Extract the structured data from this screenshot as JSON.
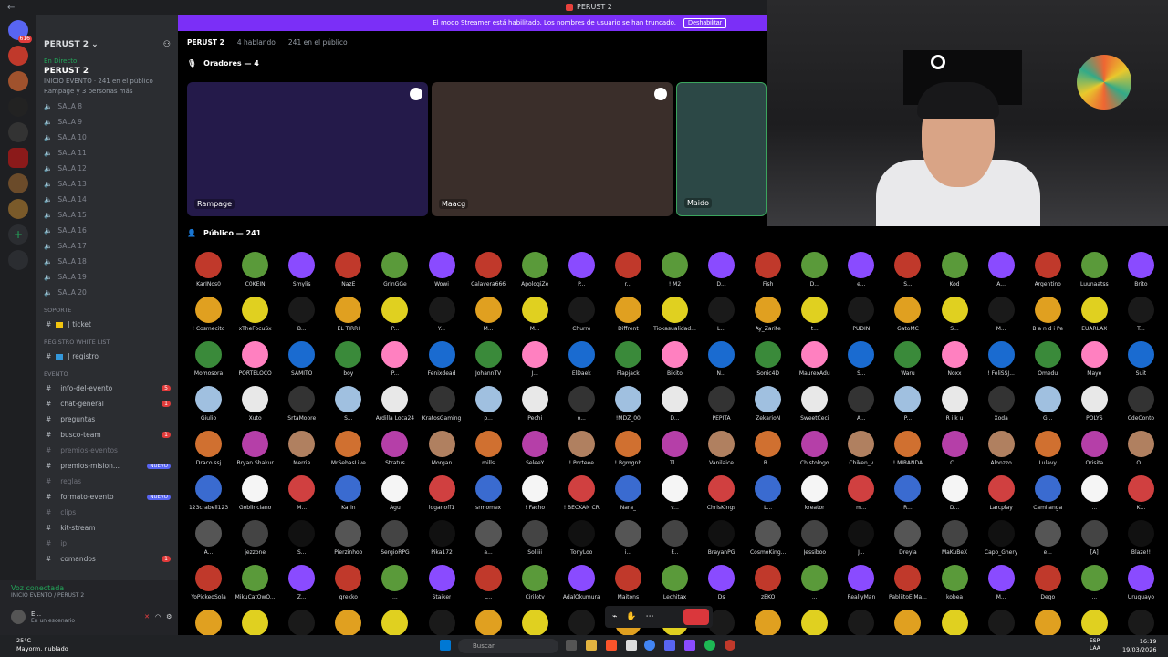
{
  "window": {
    "title": "PERUST 2"
  },
  "banner": {
    "text": "El modo Streamer está habilitado. Los nombres de usuario se han truncado.",
    "button": "Deshabilitar"
  },
  "server": {
    "name": "PERUST 2 ⌄",
    "live_label": "En Directo",
    "live_title": "PERUST 2",
    "live_sub1": "INICIO EVENTO · 241 en el público",
    "live_sub2": "Rampage y 3 personas más"
  },
  "voice_channels": [
    "SALA 8",
    "SALA 9",
    "SALA 10",
    "SALA 11",
    "SALA 12",
    "SALA 13",
    "SALA 14",
    "SALA 15",
    "SALA 16",
    "SALA 17",
    "SALA 18",
    "SALA 19",
    "SALA 20"
  ],
  "categories": {
    "soporte": "SOPORTE",
    "registro": "REGISTRO WHITE LIST",
    "evento": "EVENTO"
  },
  "text_channels": {
    "ticket": "| ticket",
    "registro": "| registro",
    "evento": [
      {
        "name": "| info-del-evento",
        "badge": "5"
      },
      {
        "name": "| chat-general",
        "badge": "1"
      },
      {
        "name": "| preguntas",
        "badge": ""
      },
      {
        "name": "| busco-team",
        "badge": "1"
      },
      {
        "name": "| premios-eventos",
        "badge": "",
        "dim": true
      },
      {
        "name": "| premios-mision...",
        "badge": "NUEVO"
      },
      {
        "name": "| reglas",
        "badge": "",
        "dim": true
      },
      {
        "name": "| formato-evento",
        "badge": "NUEVO"
      },
      {
        "name": "| clips",
        "badge": "",
        "dim": true
      },
      {
        "name": "| kit-stream",
        "badge": ""
      },
      {
        "name": "| ip",
        "badge": "",
        "dim": true
      },
      {
        "name": "| comandos",
        "badge": "1"
      }
    ]
  },
  "voice_status": {
    "title": "Voz conectada",
    "sub": "INICIO EVENTO / PERUST 2",
    "user": "E...",
    "user_sub": "En un escenario"
  },
  "stage": {
    "title": "PERUST 2",
    "speaking": "4 hablando",
    "audience": "241 en el público",
    "speakers_label": "Oradores — 4",
    "audience_label": "Público — 241"
  },
  "speakers": [
    {
      "name": "Rampage",
      "color": "#241a4a"
    },
    {
      "name": "Maacg",
      "color": "#3a2e2a"
    },
    {
      "name": "Maido",
      "color": "#2c4846"
    }
  ],
  "audience_names": [
    "KarIÑos0",
    "C0KEIN",
    "Smylis",
    "NazE",
    "GrinGGe",
    "Wowi",
    "Calavera666",
    "ApologiZe",
    "P...",
    "r...",
    "! M2",
    "D...",
    "Fish",
    "D...",
    "e...",
    "S...",
    "Kod",
    "A...",
    "Argentino",
    "Luunaatss",
    "Brito",
    "! Cosmecito",
    "xTheFocuSx",
    "B...",
    "EL TIRRI",
    "P...",
    "Y...",
    "M...",
    "M...",
    "Churro",
    "Diffrent",
    "Tiokasualidad...",
    "L...",
    "Ay_Zarite",
    "t...",
    "PUDIN",
    "GatoMC",
    "S...",
    "M...",
    "B a n d i Pe",
    "EUARLAX",
    "T...",
    "Momosora",
    "PORTELOCO",
    "SAMITO",
    "boy",
    "P...",
    "Fenixdead",
    "JohannTV",
    "J...",
    "ElDaek",
    "Flapjack",
    "Bikito",
    "N...",
    "Sonic4D",
    "MaurexAdu",
    "S...",
    "Waru",
    "Noxx",
    "! FeliSSJ...",
    "Omedu",
    "Maye",
    "Suit",
    "Giulio",
    "Xuto",
    "SrtaMoore",
    "S...",
    "Ardilla Loca24",
    "KratosGaming",
    "p...",
    "Pechi",
    "o...",
    "!MDZ_00",
    "D...",
    "PEPITA",
    "ZekarioN",
    "SweetCeci",
    "A...",
    "P...",
    "R i k u",
    "Xoda",
    "G...",
    "POLYS",
    "CdeConto",
    "Draco ssj",
    "Bryan Shakur",
    "Merrie",
    "MrSebasLive",
    "Stratus",
    "Morgan",
    "mills",
    "SeleeY",
    "! Porteee",
    "! Bgmgnh",
    "Tl...",
    "Vanilaice",
    "R...",
    "Chistologo",
    "Chiken_v",
    "! MIRANDA",
    "C...",
    "Alonzzo",
    "Lulavy",
    "Orisita",
    "O...",
    "123crabell123",
    "Goblinciano",
    "M...",
    "Karin",
    "Agu",
    "loganoff1",
    "srmomex",
    "! Facho",
    "! BECKAN CR",
    "Nara_",
    "v...",
    "ChrisKings",
    "L...",
    "kreator",
    "m...",
    "R...",
    "D...",
    "Larcplay",
    "Camilanga",
    "...",
    "K...",
    "A...",
    "jezzone",
    "S...",
    "Pierzinhoo",
    "SergioRPG",
    "Pika172",
    "a...",
    "Soliiii",
    "TonyLoo",
    "i...",
    "F...",
    "BrayanPG",
    "CosmoKing...",
    "Jessiboo",
    "J...",
    "Dreyla",
    "MaKuBeX",
    "Capo_Ghery",
    "e...",
    "[A]",
    "Blaze!!",
    "YoPickeoSola",
    "MikuCatOwO...",
    "Z...",
    "grekko",
    "...",
    "Staiker",
    "L...",
    "Cirilotv",
    "AdalOkumura",
    "Maitons",
    "Lechitax",
    "Ds",
    "zEKO",
    "...",
    "ReallyMan",
    "PabliitoElMa...",
    "kobea",
    "M...",
    "Dego",
    "...",
    "Uruguayo",
    "...",
    "...",
    "...",
    "...",
    "...",
    "...",
    "...",
    "...",
    "...",
    "...",
    "...",
    "...",
    "...",
    "...",
    "...",
    "...",
    "...",
    "...",
    "...",
    "...",
    "..."
  ],
  "taskbar": {
    "weather_temp": "25°C",
    "weather_desc": "Mayorm. nublado",
    "search": "Buscar",
    "lang1": "ESP",
    "lang2": "LAA",
    "time": "16:19",
    "date": "19/03/2026"
  }
}
